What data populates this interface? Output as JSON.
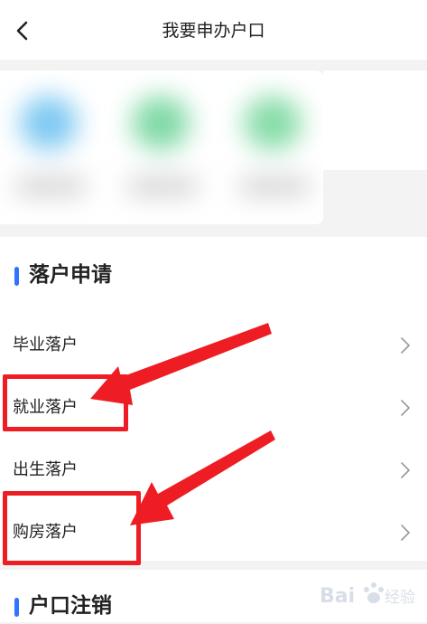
{
  "header": {
    "title": "我要申办户口",
    "back_icon": "chevron-left-icon"
  },
  "shortcuts": {
    "tile_colors": [
      "#7ec9f2",
      "#7fd9a6",
      "#86dca8"
    ]
  },
  "sections": [
    {
      "title": "落户申请",
      "accent_color": "#2f74ff",
      "items": [
        {
          "label": "毕业落户",
          "icon": "chevron-right-icon"
        },
        {
          "label": "就业落户",
          "icon": "chevron-right-icon"
        },
        {
          "label": "出生落户",
          "icon": "chevron-right-icon"
        },
        {
          "label": "购房落户",
          "icon": "chevron-right-icon"
        }
      ]
    },
    {
      "title": "户口注销",
      "accent_color": "#2f74ff"
    }
  ],
  "annotations": {
    "color": "#ee1d24",
    "highlighted_items": [
      "就业落户",
      "购房落户"
    ]
  },
  "watermark": {
    "text": "Bai 经验",
    "icon": "paw-logo-icon"
  }
}
